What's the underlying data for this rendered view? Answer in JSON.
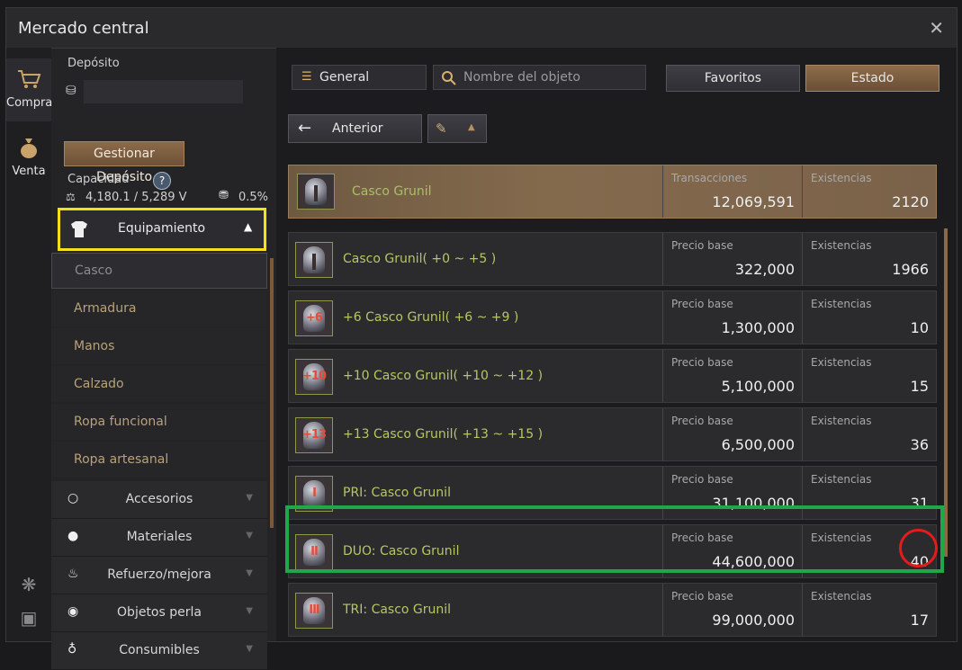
{
  "window": {
    "title": "Mercado central",
    "close_label": "✕"
  },
  "side_tabs": [
    {
      "label": "Compra",
      "icon": "cart-icon",
      "active": true
    },
    {
      "label": "Venta",
      "icon": "money-bag-icon",
      "active": false
    }
  ],
  "deposit": {
    "label": "Depósito",
    "manage_button": "Gestionar Depósito",
    "capacity_label": "Capacidad",
    "capacity_value": "4,180.1 / 5,289 V",
    "tax_value": "0.5%"
  },
  "categories": {
    "open": {
      "label": "Equipamiento",
      "icon": "armor-icon"
    },
    "subitems": [
      "Casco",
      "Armadura",
      "Manos",
      "Calzado",
      "Ropa funcional",
      "Ropa artesanal"
    ],
    "selected_subitem": "Casco",
    "closed": [
      {
        "label": "Accesorios",
        "icon": "ring-icon"
      },
      {
        "label": "Materiales",
        "icon": "materials-icon"
      },
      {
        "label": "Refuerzo/mejora",
        "icon": "flame-icon"
      },
      {
        "label": "Objetos perla",
        "icon": "pearl-icon"
      },
      {
        "label": "Consumibles",
        "icon": "potion-icon"
      }
    ]
  },
  "toolbar": {
    "general_label": "General",
    "search_placeholder": "Nombre del objeto",
    "favorites_label": "Favoritos",
    "status_label": "Estado",
    "back_label": "Anterior"
  },
  "featured": {
    "name": "Casco Grunil",
    "col1_label": "Transacciones",
    "col1_value": "12,069,591",
    "col2_label": "Existencias",
    "col2_value": "2120"
  },
  "rows": [
    {
      "badge": "",
      "name": "Casco Grunil( +0 ~ +5 )",
      "price_label": "Precio base",
      "price": "322,000",
      "stock_label": "Existencias",
      "stock": "1966"
    },
    {
      "badge": "+6",
      "name": "+6 Casco Grunil( +6 ~ +9 )",
      "price_label": "Precio base",
      "price": "1,300,000",
      "stock_label": "Existencias",
      "stock": "10"
    },
    {
      "badge": "+10",
      "name": "+10 Casco Grunil( +10 ~ +12 )",
      "price_label": "Precio base",
      "price": "5,100,000",
      "stock_label": "Existencias",
      "stock": "15"
    },
    {
      "badge": "+13",
      "name": "+13 Casco Grunil( +13 ~ +15 )",
      "price_label": "Precio base",
      "price": "6,500,000",
      "stock_label": "Existencias",
      "stock": "36"
    },
    {
      "badge": "I",
      "name": "PRI: Casco Grunil",
      "price_label": "Precio base",
      "price": "31,100,000",
      "stock_label": "Existencias",
      "stock": "31"
    },
    {
      "badge": "II",
      "name": "DUO: Casco Grunil",
      "price_label": "Precio base",
      "price": "44,600,000",
      "stock_label": "Existencias",
      "stock": "40"
    },
    {
      "badge": "III",
      "name": "TRI: Casco Grunil",
      "price_label": "Precio base",
      "price": "99,000,000",
      "stock_label": "Existencias",
      "stock": "17"
    }
  ]
}
